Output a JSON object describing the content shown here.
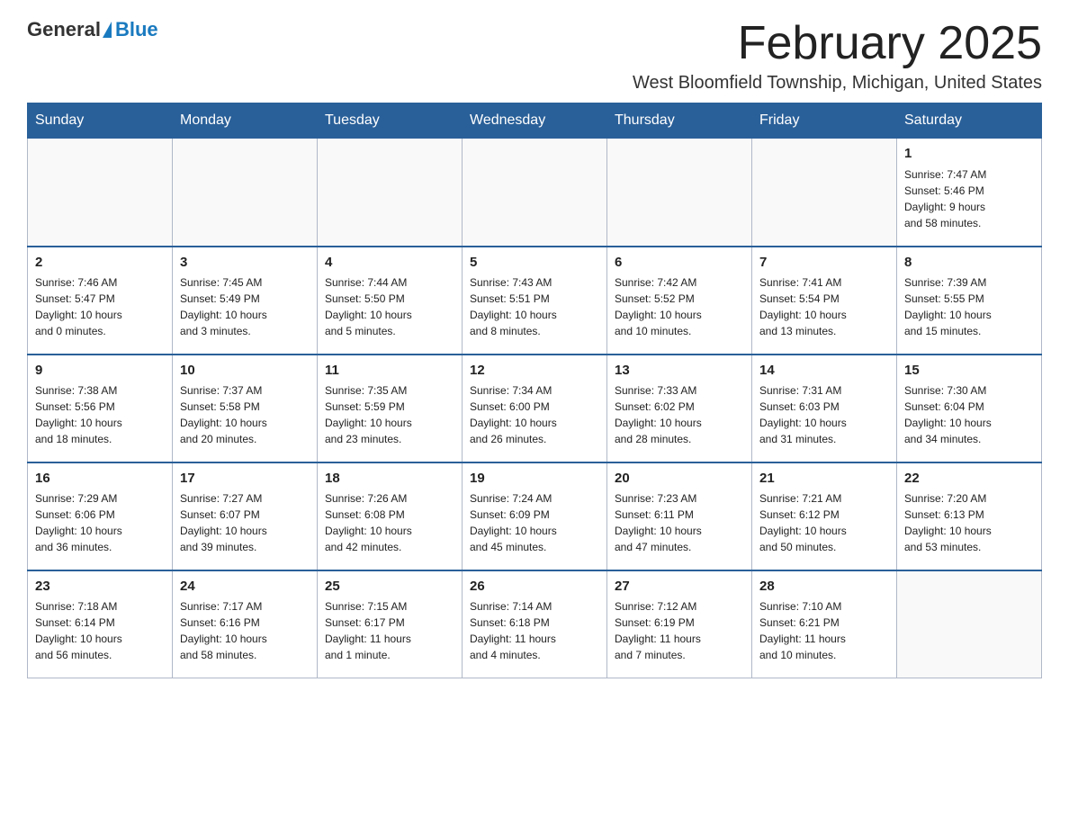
{
  "header": {
    "logo_general": "General",
    "logo_blue": "Blue",
    "month_title": "February 2025",
    "location": "West Bloomfield Township, Michigan, United States"
  },
  "weekdays": [
    "Sunday",
    "Monday",
    "Tuesday",
    "Wednesday",
    "Thursday",
    "Friday",
    "Saturday"
  ],
  "weeks": [
    [
      {
        "day": "",
        "info": ""
      },
      {
        "day": "",
        "info": ""
      },
      {
        "day": "",
        "info": ""
      },
      {
        "day": "",
        "info": ""
      },
      {
        "day": "",
        "info": ""
      },
      {
        "day": "",
        "info": ""
      },
      {
        "day": "1",
        "info": "Sunrise: 7:47 AM\nSunset: 5:46 PM\nDaylight: 9 hours\nand 58 minutes."
      }
    ],
    [
      {
        "day": "2",
        "info": "Sunrise: 7:46 AM\nSunset: 5:47 PM\nDaylight: 10 hours\nand 0 minutes."
      },
      {
        "day": "3",
        "info": "Sunrise: 7:45 AM\nSunset: 5:49 PM\nDaylight: 10 hours\nand 3 minutes."
      },
      {
        "day": "4",
        "info": "Sunrise: 7:44 AM\nSunset: 5:50 PM\nDaylight: 10 hours\nand 5 minutes."
      },
      {
        "day": "5",
        "info": "Sunrise: 7:43 AM\nSunset: 5:51 PM\nDaylight: 10 hours\nand 8 minutes."
      },
      {
        "day": "6",
        "info": "Sunrise: 7:42 AM\nSunset: 5:52 PM\nDaylight: 10 hours\nand 10 minutes."
      },
      {
        "day": "7",
        "info": "Sunrise: 7:41 AM\nSunset: 5:54 PM\nDaylight: 10 hours\nand 13 minutes."
      },
      {
        "day": "8",
        "info": "Sunrise: 7:39 AM\nSunset: 5:55 PM\nDaylight: 10 hours\nand 15 minutes."
      }
    ],
    [
      {
        "day": "9",
        "info": "Sunrise: 7:38 AM\nSunset: 5:56 PM\nDaylight: 10 hours\nand 18 minutes."
      },
      {
        "day": "10",
        "info": "Sunrise: 7:37 AM\nSunset: 5:58 PM\nDaylight: 10 hours\nand 20 minutes."
      },
      {
        "day": "11",
        "info": "Sunrise: 7:35 AM\nSunset: 5:59 PM\nDaylight: 10 hours\nand 23 minutes."
      },
      {
        "day": "12",
        "info": "Sunrise: 7:34 AM\nSunset: 6:00 PM\nDaylight: 10 hours\nand 26 minutes."
      },
      {
        "day": "13",
        "info": "Sunrise: 7:33 AM\nSunset: 6:02 PM\nDaylight: 10 hours\nand 28 minutes."
      },
      {
        "day": "14",
        "info": "Sunrise: 7:31 AM\nSunset: 6:03 PM\nDaylight: 10 hours\nand 31 minutes."
      },
      {
        "day": "15",
        "info": "Sunrise: 7:30 AM\nSunset: 6:04 PM\nDaylight: 10 hours\nand 34 minutes."
      }
    ],
    [
      {
        "day": "16",
        "info": "Sunrise: 7:29 AM\nSunset: 6:06 PM\nDaylight: 10 hours\nand 36 minutes."
      },
      {
        "day": "17",
        "info": "Sunrise: 7:27 AM\nSunset: 6:07 PM\nDaylight: 10 hours\nand 39 minutes."
      },
      {
        "day": "18",
        "info": "Sunrise: 7:26 AM\nSunset: 6:08 PM\nDaylight: 10 hours\nand 42 minutes."
      },
      {
        "day": "19",
        "info": "Sunrise: 7:24 AM\nSunset: 6:09 PM\nDaylight: 10 hours\nand 45 minutes."
      },
      {
        "day": "20",
        "info": "Sunrise: 7:23 AM\nSunset: 6:11 PM\nDaylight: 10 hours\nand 47 minutes."
      },
      {
        "day": "21",
        "info": "Sunrise: 7:21 AM\nSunset: 6:12 PM\nDaylight: 10 hours\nand 50 minutes."
      },
      {
        "day": "22",
        "info": "Sunrise: 7:20 AM\nSunset: 6:13 PM\nDaylight: 10 hours\nand 53 minutes."
      }
    ],
    [
      {
        "day": "23",
        "info": "Sunrise: 7:18 AM\nSunset: 6:14 PM\nDaylight: 10 hours\nand 56 minutes."
      },
      {
        "day": "24",
        "info": "Sunrise: 7:17 AM\nSunset: 6:16 PM\nDaylight: 10 hours\nand 58 minutes."
      },
      {
        "day": "25",
        "info": "Sunrise: 7:15 AM\nSunset: 6:17 PM\nDaylight: 11 hours\nand 1 minute."
      },
      {
        "day": "26",
        "info": "Sunrise: 7:14 AM\nSunset: 6:18 PM\nDaylight: 11 hours\nand 4 minutes."
      },
      {
        "day": "27",
        "info": "Sunrise: 7:12 AM\nSunset: 6:19 PM\nDaylight: 11 hours\nand 7 minutes."
      },
      {
        "day": "28",
        "info": "Sunrise: 7:10 AM\nSunset: 6:21 PM\nDaylight: 11 hours\nand 10 minutes."
      },
      {
        "day": "",
        "info": ""
      }
    ]
  ]
}
